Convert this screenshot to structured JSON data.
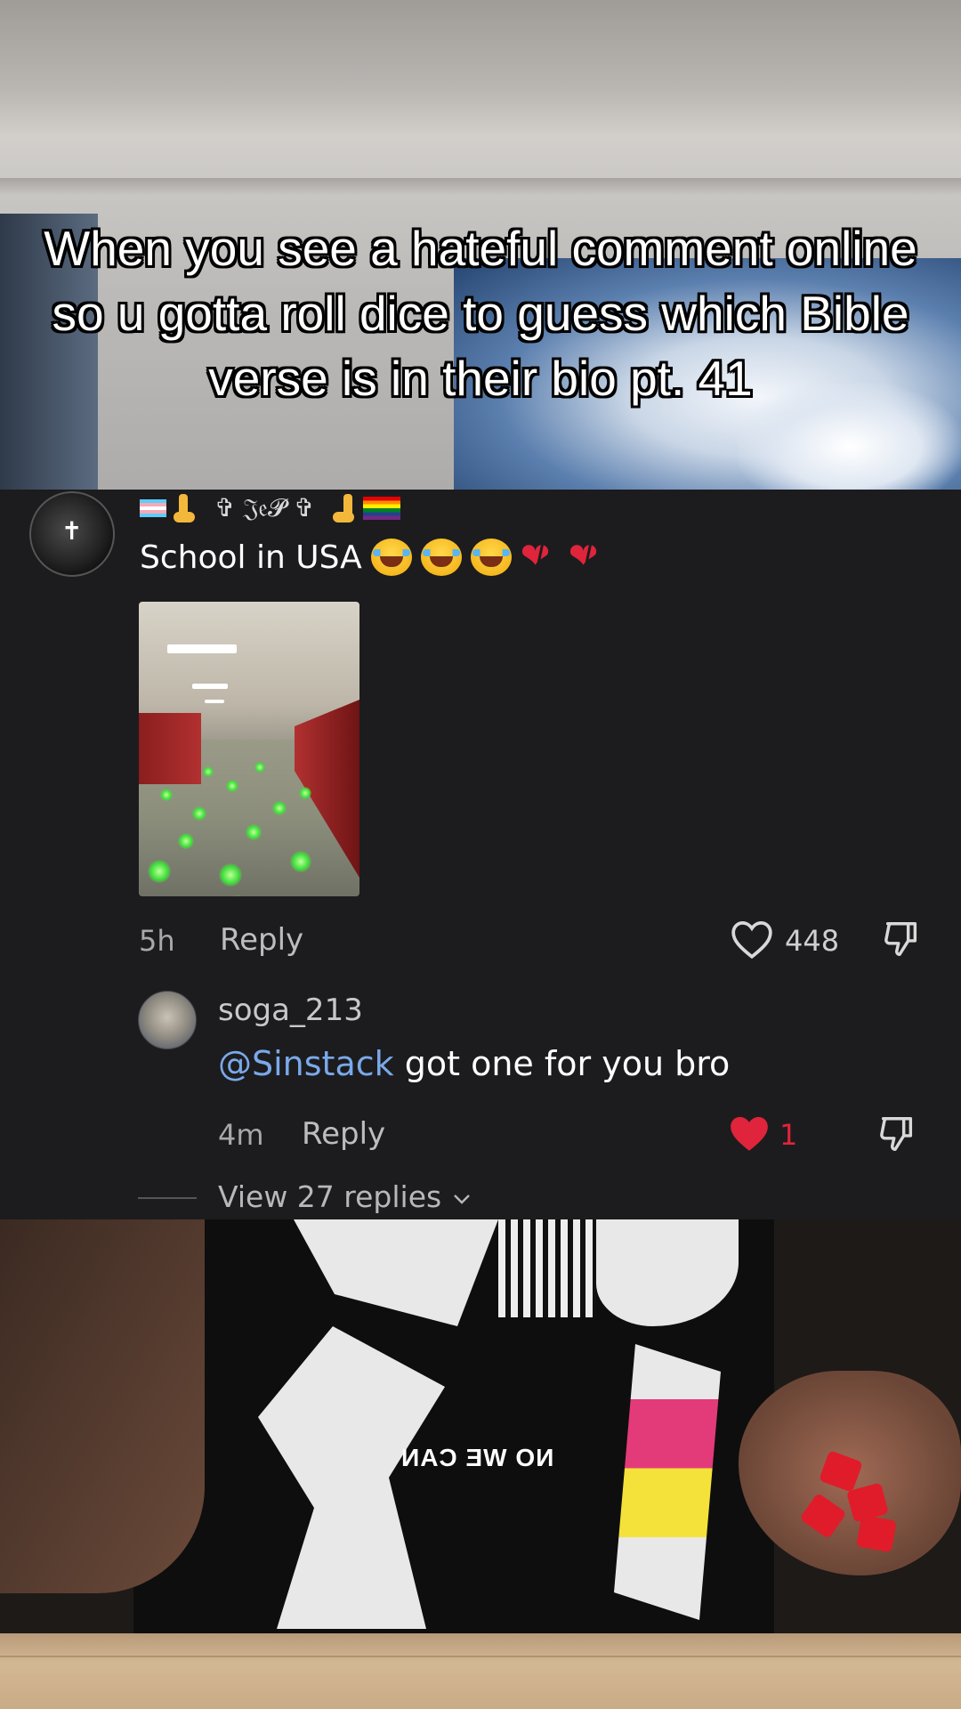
{
  "video_caption": "When you see a hateful comment online so u gotta roll dice to guess which Bible verse is in their bio pt. 41",
  "comment": {
    "username_text": "✞ 𝔍𝔢𝓟 ✞",
    "text": "School in USA",
    "time": "5h",
    "reply_label": "Reply",
    "like_count": "448"
  },
  "reply": {
    "username": "soga_213",
    "mention": "@Sinstack",
    "text": " got one for you bro",
    "time": "4m",
    "reply_label": "Reply",
    "like_count": "1",
    "liked": true
  },
  "view_replies": "View 27 replies",
  "colors": {
    "panel_bg": "#1c1c1e",
    "mention": "#7aa9ea",
    "liked_heart": "#e0243b"
  },
  "icons": [
    "heart-outline-icon",
    "dislike-icon",
    "heart-filled-icon",
    "chevron-down-icon",
    "laughing-emoji",
    "broken-heart-emoji",
    "trans-flag-emoji",
    "rainbow-flag-emoji"
  ]
}
